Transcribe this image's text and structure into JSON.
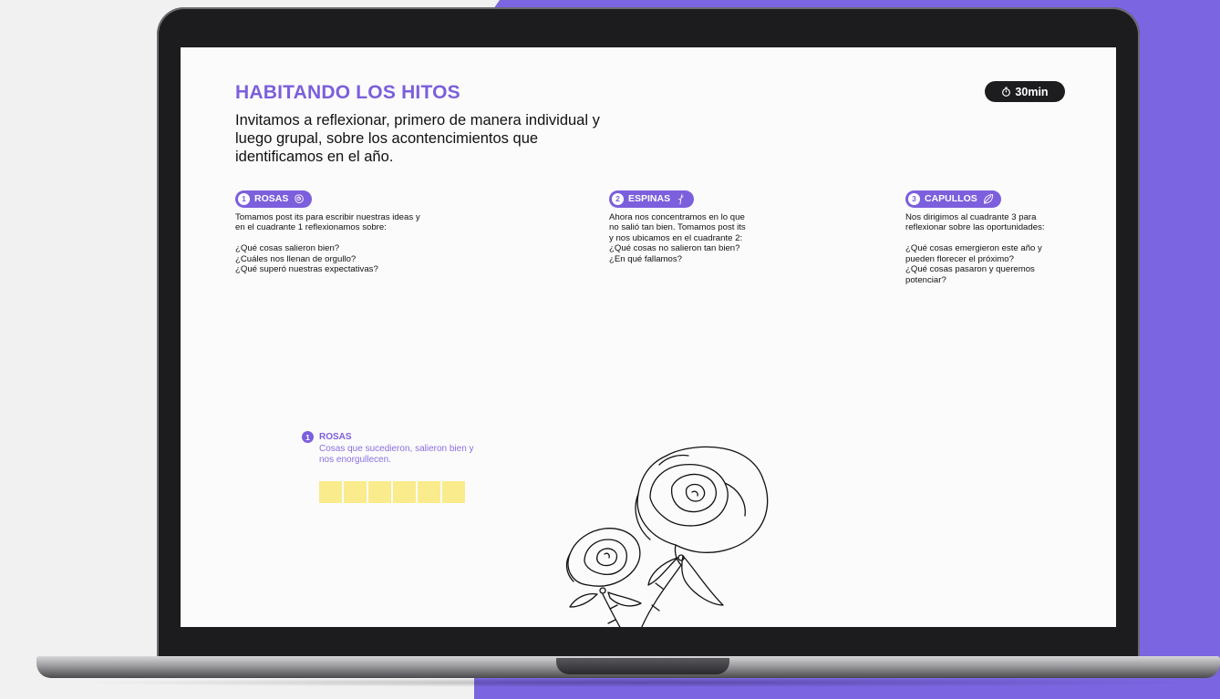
{
  "header": {
    "title": "HABITANDO LOS HITOS",
    "intro": "Invitamos a reflexionar, primero de manera individual y luego grupal, sobre los acontencimientos que identificamos en el año.",
    "timer_label": "30min",
    "timer_icon": "stopwatch-icon"
  },
  "sections": [
    {
      "number": "1",
      "label": "ROSAS",
      "icon": "rose-icon",
      "text": "Tomamos post its para escribir nuestras ideas y\nen el cuadrante 1 reflexionamos sobre:\n\n¿Qué cosas salieron bien?\n¿Cuáles nos llenan de orgullo?\n¿Qué superó nuestras expectativas?"
    },
    {
      "number": "2",
      "label": "ESPINAS",
      "icon": "thorn-icon",
      "text": "Ahora nos concentramos en lo que\nno salió tan bien. Tomamos post its\ny nos ubicamos en el cuadrante 2:\n¿Qué cosas no salieron tan bien?\n¿En qué fallamos?"
    },
    {
      "number": "3",
      "label": "CAPULLOS",
      "icon": "bud-icon",
      "text": "Nos dirigimos al cuadrante 3 para\nreflexionar sobre las oportunidades:\n\n¿Qué cosas emergieron este año y\npueden florecer el próximo?\n¿Qué cosas pasaron y queremos\npotenciar?"
    }
  ],
  "board": {
    "legend_number": "1",
    "legend_title": "ROSAS",
    "legend_subtitle": "Cosas que sucedieron, salieron bien y nos enorgullecen.",
    "postit_count": 6,
    "postit_color": "#faeb8c"
  },
  "colors": {
    "accent": "#7b5fdc",
    "background_right": "#7b65e0",
    "timer_bg": "#1d1d1f"
  }
}
